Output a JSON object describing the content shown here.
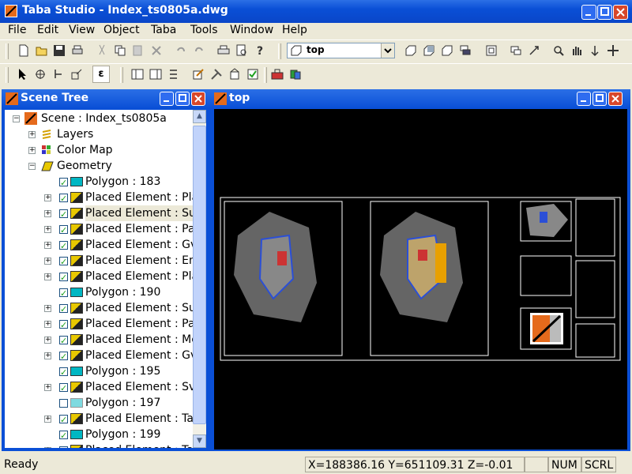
{
  "window": {
    "title": "Taba Studio - Index_ts0805a.dwg"
  },
  "menu": [
    "File",
    "Edit",
    "View",
    "Object",
    "Taba",
    "Tools",
    "Window",
    "Help"
  ],
  "toolbar": {
    "view_combo_value": "top"
  },
  "scene_tree": {
    "title": "Scene Tree",
    "root": "Scene : Index_ts0805a",
    "nodes": [
      "Layers",
      "Color Map",
      "Geometry"
    ],
    "items": [
      {
        "label": "Polygon : 183",
        "type": "polygon",
        "checked": true,
        "expandable": false
      },
      {
        "label": "Placed Element : Plar",
        "type": "placed",
        "checked": true,
        "expandable": true
      },
      {
        "label": "Placed Element : Sur",
        "type": "placed",
        "checked": true,
        "expandable": true,
        "selected": true
      },
      {
        "label": "Placed Element : Par",
        "type": "placed",
        "checked": true,
        "expandable": true
      },
      {
        "label": "Placed Element : Gvu",
        "type": "placed",
        "checked": true,
        "expandable": true
      },
      {
        "label": "Placed Element : Ent",
        "type": "placed",
        "checked": true,
        "expandable": true
      },
      {
        "label": "Placed Element : Plar",
        "type": "placed",
        "checked": true,
        "expandable": true
      },
      {
        "label": "Polygon : 190",
        "type": "polygon",
        "checked": true,
        "expandable": false
      },
      {
        "label": "Placed Element : Sur",
        "type": "placed",
        "checked": true,
        "expandable": true
      },
      {
        "label": "Placed Element : Par",
        "type": "placed",
        "checked": true,
        "expandable": true
      },
      {
        "label": "Placed Element : Mer",
        "type": "placed",
        "checked": true,
        "expandable": true
      },
      {
        "label": "Placed Element : Gvu",
        "type": "placed",
        "checked": true,
        "expandable": true
      },
      {
        "label": "Polygon : 195",
        "type": "polygon",
        "checked": true,
        "expandable": false
      },
      {
        "label": "Placed Element : Sviv",
        "type": "placed",
        "checked": true,
        "expandable": true
      },
      {
        "label": "Polygon : 197",
        "type": "polygon",
        "checked": false,
        "expandable": false
      },
      {
        "label": "Placed Element : Tab",
        "type": "placed",
        "checked": true,
        "expandable": true
      },
      {
        "label": "Polygon : 199",
        "type": "polygon",
        "checked": true,
        "expandable": false
      },
      {
        "label": "Placed Element : Tab",
        "type": "placed",
        "checked": true,
        "expandable": true
      }
    ]
  },
  "view_pane": {
    "title": "top"
  },
  "status": {
    "text": "Ready",
    "coords": "X=188386.16 Y=651109.31 Z=-0.01",
    "num": "NUM",
    "scrl": "SCRL"
  },
  "colors": {
    "titlebar": "#0a4fd6",
    "canvas": "#000000",
    "close": "#d8472a"
  }
}
